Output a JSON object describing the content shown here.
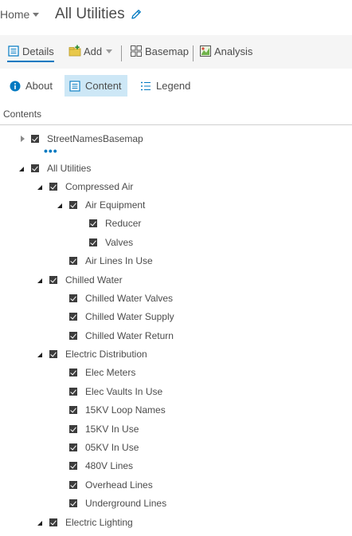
{
  "header": {
    "home_label": "Home",
    "title": "All Utilities"
  },
  "toolbar": {
    "details_label": "Details",
    "add_label": "Add",
    "basemap_label": "Basemap",
    "analysis_label": "Analysis"
  },
  "subtabs": {
    "about_label": "About",
    "content_label": "Content",
    "legend_label": "Legend"
  },
  "contents_heading": "Contents",
  "tree": [
    {
      "label": "StreetNamesBasemap",
      "level": 0,
      "expander": "collapsed",
      "checked": true
    },
    {
      "label": "All Utilities",
      "level": 0,
      "expander": "expanded",
      "checked": true
    },
    {
      "label": "Compressed Air",
      "level": 1,
      "expander": "expanded",
      "checked": true
    },
    {
      "label": "Air Equipment",
      "level": 2,
      "expander": "expanded",
      "checked": true
    },
    {
      "label": "Reducer",
      "level": 3,
      "expander": "none",
      "checked": true
    },
    {
      "label": "Valves",
      "level": 3,
      "expander": "none",
      "checked": true
    },
    {
      "label": "Air Lines In Use",
      "level": 2,
      "expander": "none",
      "checked": true
    },
    {
      "label": "Chilled Water",
      "level": 1,
      "expander": "expanded",
      "checked": true
    },
    {
      "label": "Chilled Water Valves",
      "level": 2,
      "expander": "none",
      "checked": true
    },
    {
      "label": "Chilled Water Supply",
      "level": 2,
      "expander": "none",
      "checked": true
    },
    {
      "label": "Chilled Water Return",
      "level": 2,
      "expander": "none",
      "checked": true
    },
    {
      "label": "Electric Distribution",
      "level": 1,
      "expander": "expanded",
      "checked": true
    },
    {
      "label": "Elec Meters",
      "level": 2,
      "expander": "none",
      "checked": true
    },
    {
      "label": "Elec Vaults In Use",
      "level": 2,
      "expander": "none",
      "checked": true
    },
    {
      "label": "15KV Loop Names",
      "level": 2,
      "expander": "none",
      "checked": true
    },
    {
      "label": "15KV In Use",
      "level": 2,
      "expander": "none",
      "checked": true
    },
    {
      "label": "05KV In Use",
      "level": 2,
      "expander": "none",
      "checked": true
    },
    {
      "label": "480V Lines",
      "level": 2,
      "expander": "none",
      "checked": true
    },
    {
      "label": "Overhead Lines",
      "level": 2,
      "expander": "none",
      "checked": true
    },
    {
      "label": "Underground Lines",
      "level": 2,
      "expander": "none",
      "checked": true
    },
    {
      "label": "Electric Lighting",
      "level": 1,
      "expander": "expanded",
      "checked": true
    }
  ],
  "colors": {
    "accent": "#0079c1",
    "selected_tab_bg": "#cde7f6",
    "toolbar_bg": "#f5f5f5"
  }
}
